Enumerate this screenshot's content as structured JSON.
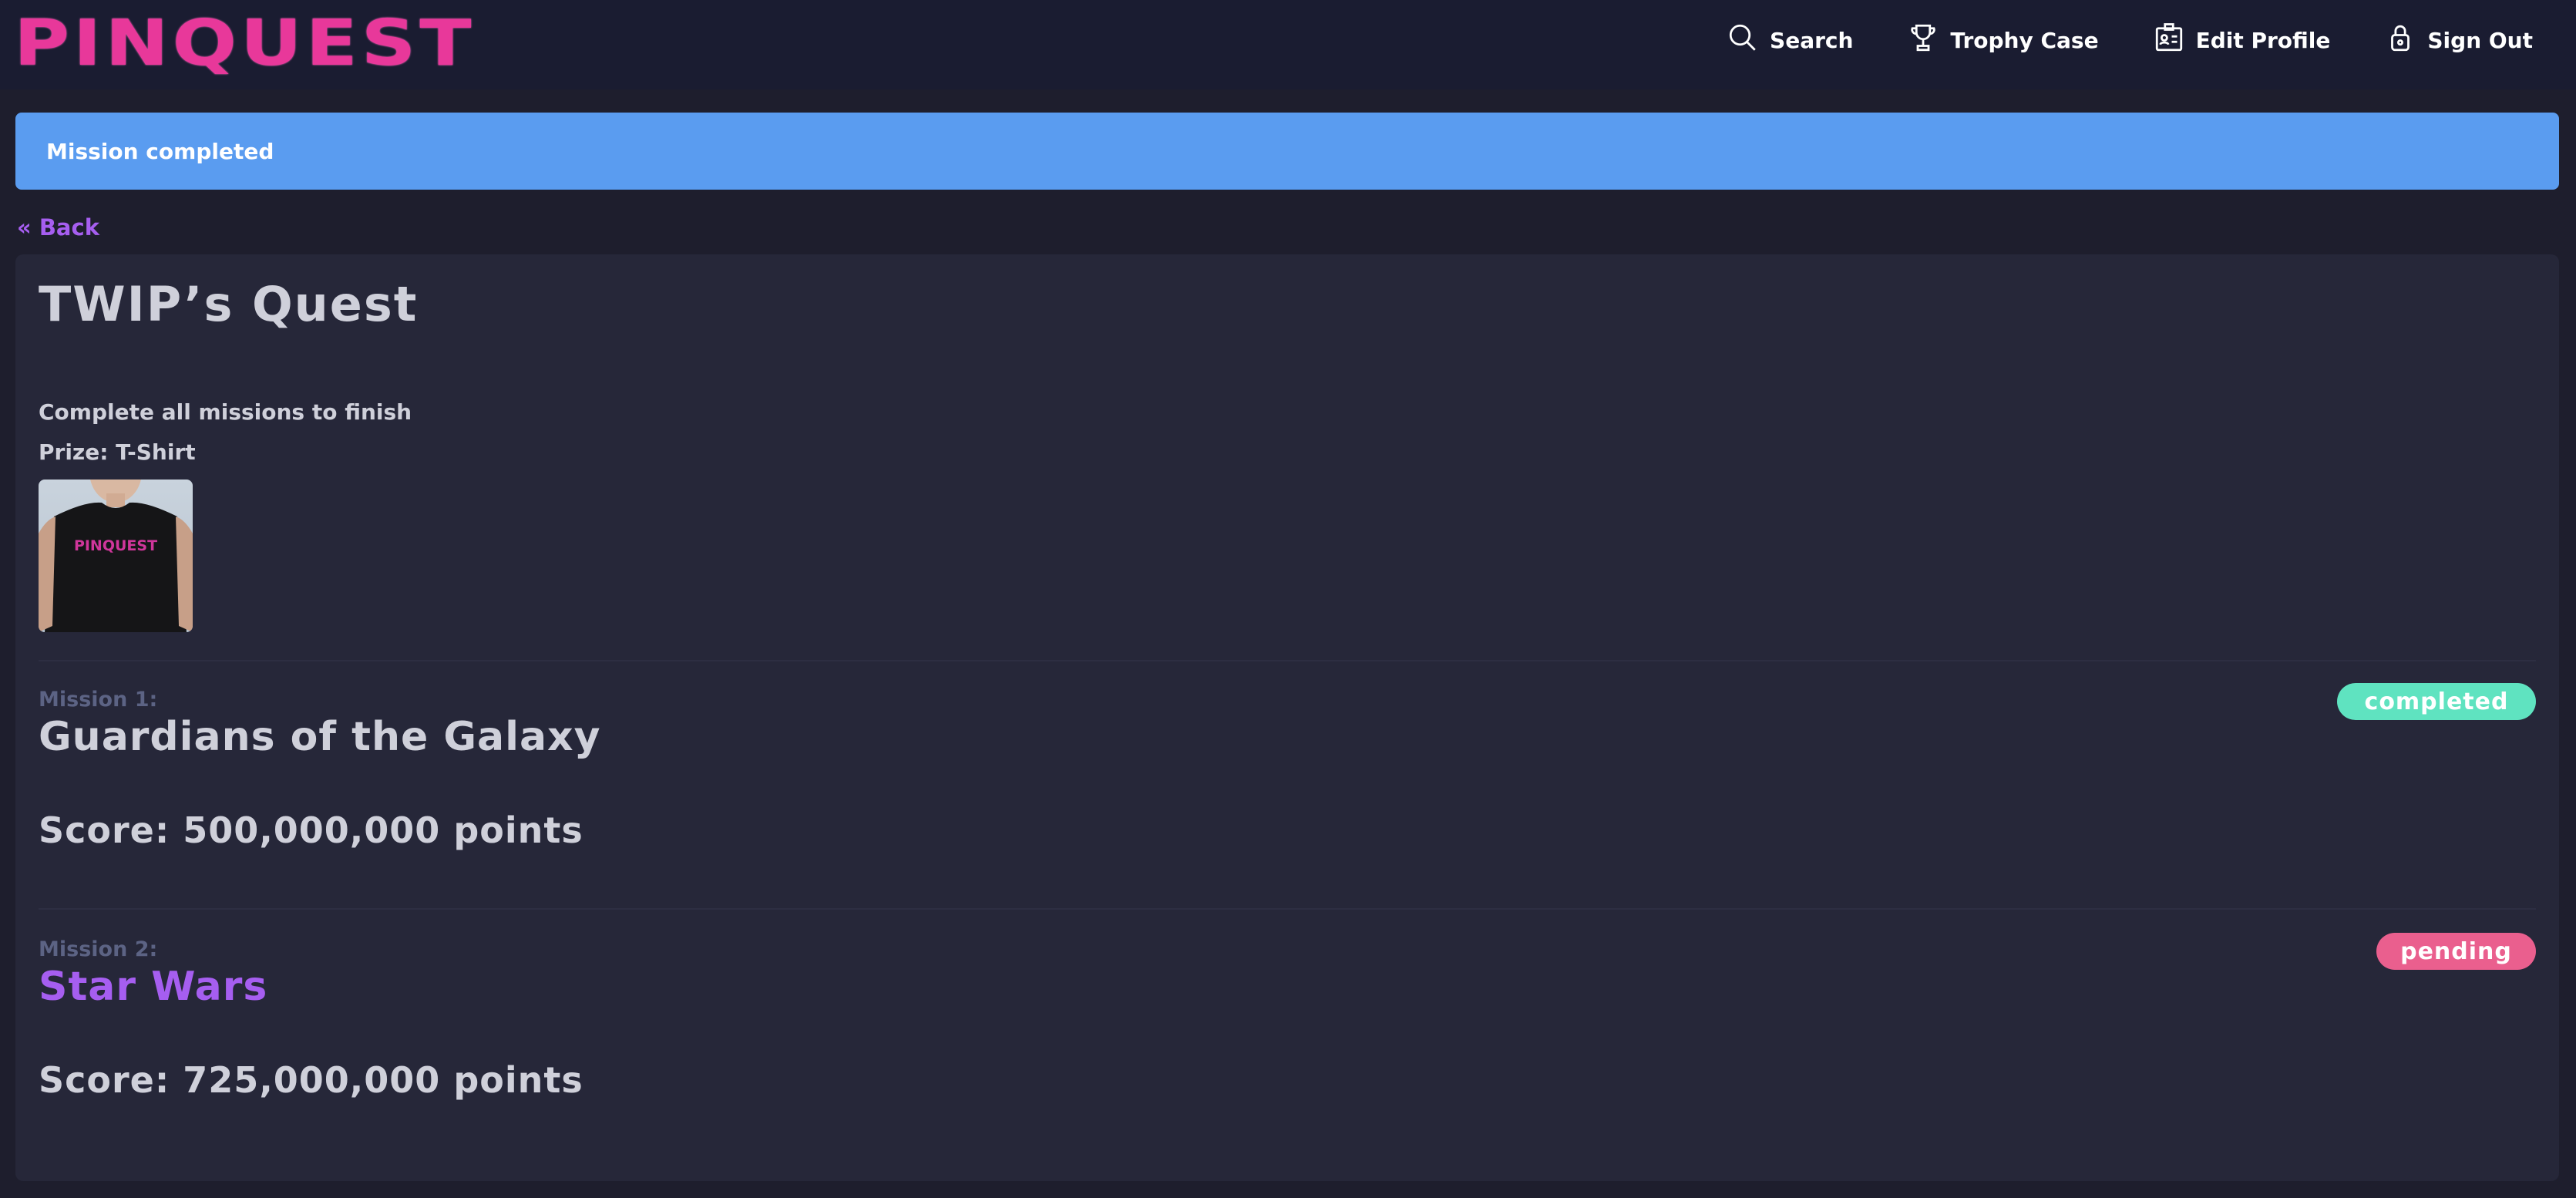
{
  "header": {
    "logo_text": "PINQUEST",
    "nav": [
      {
        "label": "Search",
        "icon": "search-icon"
      },
      {
        "label": "Trophy Case",
        "icon": "trophy-icon"
      },
      {
        "label": "Edit Profile",
        "icon": "id-card-icon"
      },
      {
        "label": "Sign Out",
        "icon": "lock-icon"
      }
    ]
  },
  "flash": {
    "message": "Mission completed"
  },
  "back_link": "« Back",
  "quest": {
    "title": "TWIP’s Quest",
    "description": "Complete all missions to finish",
    "prize": "Prize: T-Shirt",
    "prize_image_text": "PINQUEST"
  },
  "missions": [
    {
      "label": "Mission 1:",
      "name": "Guardians of the Galaxy",
      "score": "Score: 500,000,000 points",
      "status": "completed",
      "name_color": "#cfd0da",
      "status_color": "#5fe3c0"
    },
    {
      "label": "Mission 2:",
      "name": "Star Wars",
      "score": "Score: 725,000,000 points",
      "status": "pending",
      "name_color": "#a65ef0",
      "status_color": "#ea5f8e"
    }
  ],
  "colors": {
    "background": "#1e1e2d",
    "header": "#1a1c31",
    "card": "#262739",
    "flash": "#5a9cf0",
    "accent_pink": "#e8389a",
    "accent_purple": "#a65ef0"
  }
}
